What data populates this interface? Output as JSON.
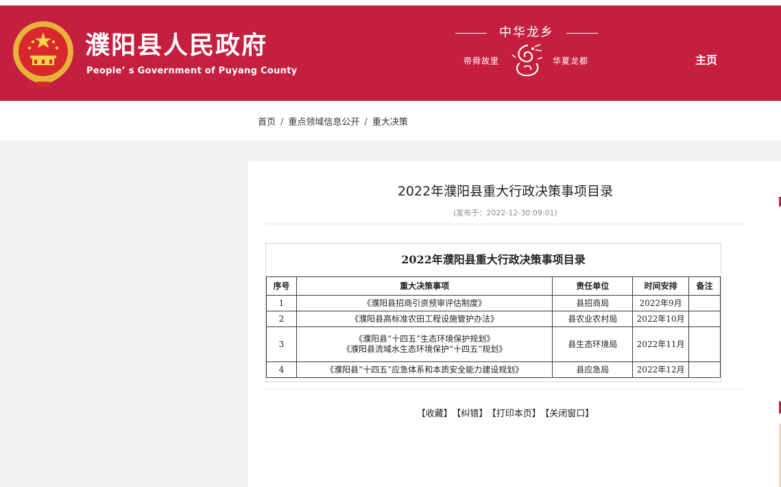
{
  "header": {
    "title": "濮阳县人民政府",
    "subtitle": "People’ s Government of Puyang County",
    "slogan_main": "中华龙乡",
    "slogan_left": "帝舜故里",
    "slogan_right": "华夏龙都",
    "nav_home": "主页",
    "brand_color": "#c41f3e"
  },
  "breadcrumb": {
    "items": [
      "首页",
      "重点领域信息公开",
      "重大决策"
    ],
    "separator": "/"
  },
  "article": {
    "title": "2022年濮阳县重大行政决策事项目录",
    "published": "(发布于：2022-12-30 09:01)",
    "table": {
      "caption": "2022年濮阳县重大行政决策事项目录",
      "headers": [
        "序号",
        "重大决策事项",
        "责任单位",
        "时间安排",
        "备注"
      ],
      "rows": [
        {
          "no": "1",
          "item_lines": [
            "《濮阳县招商引资预审评估制度》"
          ],
          "unit": "县招商局",
          "time": "2022年9月",
          "note": ""
        },
        {
          "no": "2",
          "item_lines": [
            "《濮阳县高标准农田工程设施管护办法》"
          ],
          "unit": "县农业农村局",
          "time": "2022年10月",
          "note": ""
        },
        {
          "no": "3",
          "item_lines": [
            "《濮阳县“十四五”生态环境保护规划》",
            "《濮阳县流域水生态环境保护“十四五”规划》"
          ],
          "unit": "县生态环境局",
          "time": "2022年11月",
          "note": ""
        },
        {
          "no": "4",
          "item_lines": [
            "《濮阳县“十四五”应急体系和本质安全能力建设规划》"
          ],
          "unit": "县应急局",
          "time": "2022年12月",
          "note": ""
        }
      ]
    },
    "actions": [
      "【收藏】",
      "【纠错】",
      "【打印本页】",
      "【关闭窗口】"
    ]
  }
}
